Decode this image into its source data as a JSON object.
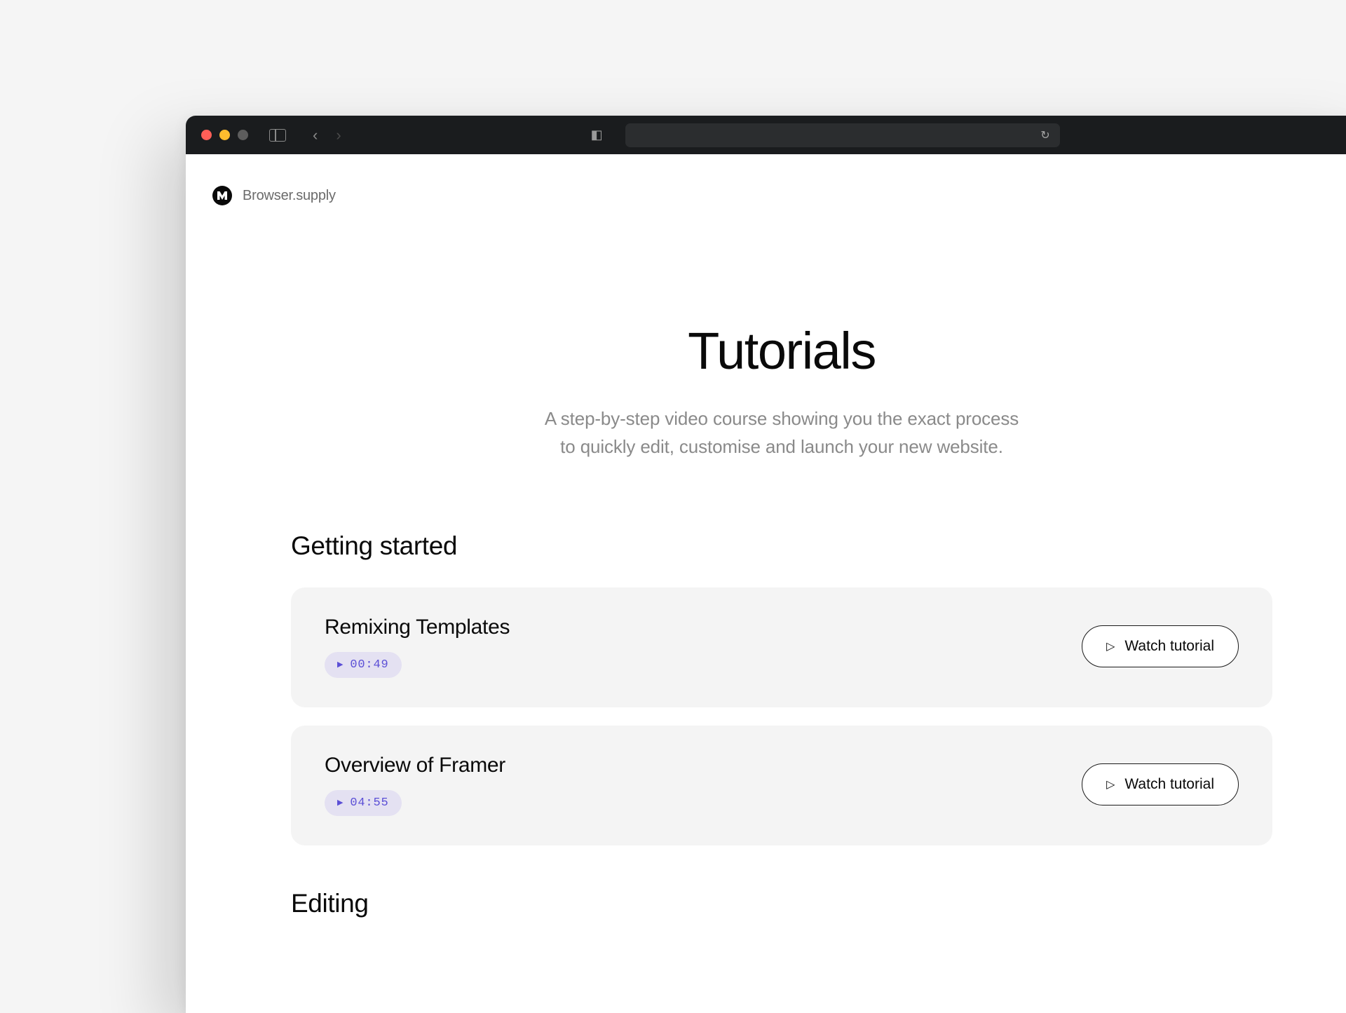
{
  "brand": {
    "name": "Browser.supply"
  },
  "hero": {
    "title": "Tutorials",
    "subtitle_line1": "A step-by-step video course showing you the exact process",
    "subtitle_line2": "to quickly edit, customise and launch your new website."
  },
  "sections": [
    {
      "title": "Getting started",
      "items": [
        {
          "title": "Remixing Templates",
          "duration": "00:49",
          "cta": "Watch tutorial"
        },
        {
          "title": "Overview of Framer",
          "duration": "04:55",
          "cta": "Watch tutorial"
        }
      ]
    },
    {
      "title": "Editing",
      "items": []
    }
  ]
}
